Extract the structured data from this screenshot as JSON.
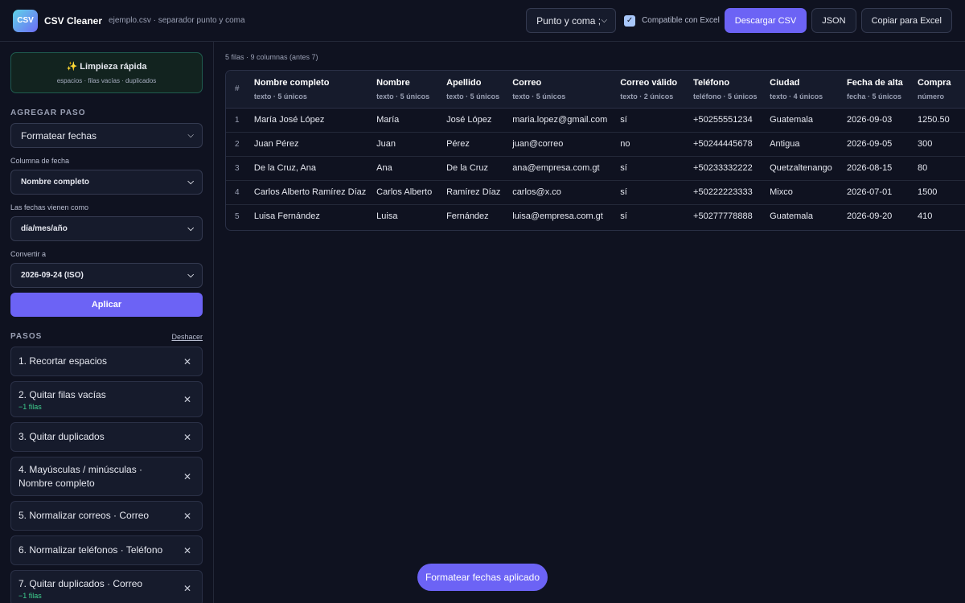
{
  "header": {
    "logo_text": "CSV",
    "app_title": "CSV Cleaner",
    "file_info": "ejemplo.csv · separador punto y coma",
    "separator_value": "Punto y coma ;",
    "excel_label": "Compatible con Excel",
    "excel_checked": true,
    "download_label": "Descargar CSV",
    "json_label": "JSON",
    "copy_label": "Copiar para Excel"
  },
  "sidebar": {
    "quick_title": "✨ Limpieza rápida",
    "quick_sub": "espacios · filas vacías · duplicados",
    "add_step_heading": "AGREGAR PASO",
    "step_type_value": "Formatear fechas",
    "date_column_label": "Columna de fecha",
    "date_column_value": "Nombre completo",
    "dates_come_as_label": "Las fechas vienen como",
    "dates_come_as_value": "día/mes/año",
    "convert_to_label": "Convertir a",
    "convert_to_value": "2026-09-24 (ISO)",
    "apply_label": "Aplicar",
    "steps_heading": "PASOS",
    "undo_label": "Deshacer",
    "steps": [
      {
        "label": "1. Recortar espacios",
        "note": ""
      },
      {
        "label": "2. Quitar filas vacías",
        "note": "−1 filas"
      },
      {
        "label": "3. Quitar duplicados",
        "note": ""
      },
      {
        "label": "4. Mayúsculas / minúsculas · Nombre completo",
        "note": ""
      },
      {
        "label": "5. Normalizar correos · Correo",
        "note": ""
      },
      {
        "label": "6. Normalizar teléfonos · Teléfono",
        "note": ""
      },
      {
        "label": "7. Quitar duplicados · Correo",
        "note": "−1 filas"
      }
    ]
  },
  "main": {
    "meta": "5 filas · 9 columnas (antes 7)",
    "index_header": "#",
    "columns": [
      {
        "name": "Nombre completo",
        "type": "texto · 5 únicos"
      },
      {
        "name": "Nombre",
        "type": "texto · 5 únicos"
      },
      {
        "name": "Apellido",
        "type": "texto · 5 únicos"
      },
      {
        "name": "Correo",
        "type": "texto · 5 únicos"
      },
      {
        "name": "Correo válido",
        "type": "texto · 2 únicos"
      },
      {
        "name": "Teléfono",
        "type": "teléfono · 5 únicos"
      },
      {
        "name": "Ciudad",
        "type": "texto · 4 únicos"
      },
      {
        "name": "Fecha de alta",
        "type": "fecha · 5 únicos"
      },
      {
        "name": "Compra",
        "type": "número"
      }
    ],
    "rows": [
      {
        "n": "1",
        "cells": [
          "María José López",
          "María",
          "José López",
          "maria.lopez@gmail.com",
          "sí",
          "+50255551234",
          "Guatemala",
          "2026-09-03",
          "1250.50"
        ]
      },
      {
        "n": "2",
        "cells": [
          "Juan Pérez",
          "Juan",
          "Pérez",
          "juan@correo",
          "no",
          "+50244445678",
          "Antigua",
          "2026-09-05",
          "300"
        ]
      },
      {
        "n": "3",
        "cells": [
          "De la Cruz, Ana",
          "Ana",
          "De la Cruz",
          "ana@empresa.com.gt",
          "sí",
          "+50233332222",
          "Quetzaltenango",
          "2026-08-15",
          "80"
        ]
      },
      {
        "n": "4",
        "cells": [
          "Carlos Alberto Ramírez Díaz",
          "Carlos Alberto",
          "Ramírez Díaz",
          "carlos@x.co",
          "sí",
          "+50222223333",
          "Mixco",
          "2026-07-01",
          "1500"
        ]
      },
      {
        "n": "5",
        "cells": [
          "Luisa Fernández",
          "Luisa",
          "Fernández",
          "luisa@empresa.com.gt",
          "sí",
          "+50277778888",
          "Guatemala",
          "2026-09-20",
          "410"
        ]
      }
    ]
  },
  "toast": {
    "text": "Formatear fechas aplicado"
  }
}
